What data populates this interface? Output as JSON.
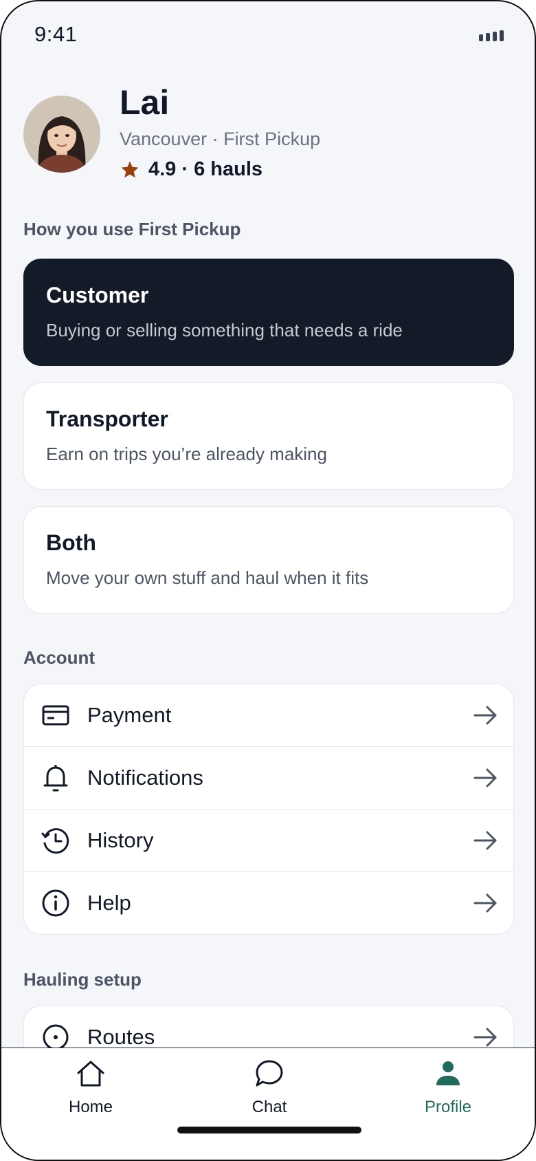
{
  "status_bar": {
    "time": "9:41"
  },
  "profile": {
    "name": "Lai",
    "subtitle": "Vancouver · First Pickup",
    "rating_text": "4.9 · 6 hauls"
  },
  "usage": {
    "heading": "How you use First Pickup",
    "options": [
      {
        "title": "Customer",
        "description": "Buying or selling something that needs a ride",
        "selected": true
      },
      {
        "title": "Transporter",
        "description": "Earn on trips you’re already making",
        "selected": false
      },
      {
        "title": "Both",
        "description": "Move your own stuff and haul when it fits",
        "selected": false
      }
    ]
  },
  "account": {
    "heading": "Account",
    "items": [
      {
        "label": "Payment",
        "icon": "credit-card-icon"
      },
      {
        "label": "Notifications",
        "icon": "bell-icon"
      },
      {
        "label": "History",
        "icon": "history-icon"
      },
      {
        "label": "Help",
        "icon": "info-icon"
      }
    ]
  },
  "hauling": {
    "heading": "Hauling setup",
    "items": [
      {
        "label": "Routes",
        "icon": "route-pin-icon"
      }
    ]
  },
  "tabbar": {
    "tabs": [
      {
        "label": "Home",
        "icon": "home-icon",
        "active": false
      },
      {
        "label": "Chat",
        "icon": "chat-bubble-icon",
        "active": false
      },
      {
        "label": "Profile",
        "icon": "person-icon",
        "active": true
      }
    ]
  },
  "colors": {
    "accent": "#1f6b5c",
    "selected_card": "#131b29",
    "star": "#9a3f0e",
    "background": "#f4f6f9"
  }
}
